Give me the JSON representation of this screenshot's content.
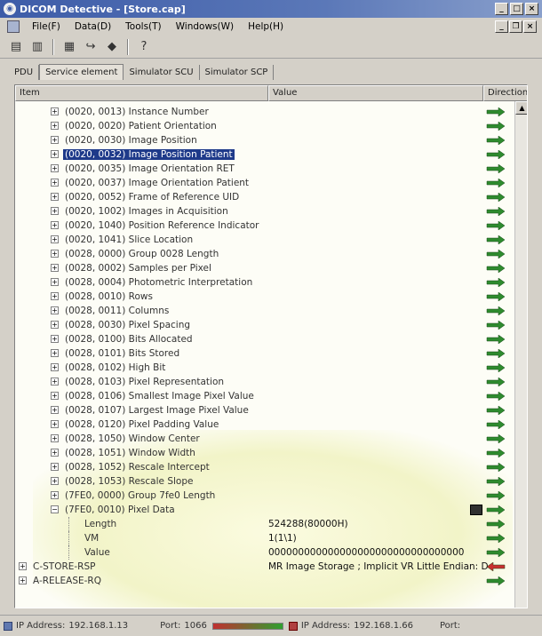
{
  "window": {
    "title": "DICOM Detective - [Store.cap]"
  },
  "menu": [
    "File(F)",
    "Data(D)",
    "Tools(T)",
    "Windows(W)",
    "Help(H)"
  ],
  "tabs": [
    "PDU",
    "Service element",
    "Simulator SCU",
    "Simulator SCP"
  ],
  "active_tab": 1,
  "columns": {
    "item": "Item",
    "value": "Value",
    "direction": "Direction"
  },
  "rows": [
    {
      "label": "(0020, 0013) Instance Number",
      "value": "",
      "dir": "out"
    },
    {
      "label": "(0020, 0020) Patient Orientation",
      "value": "",
      "dir": "out"
    },
    {
      "label": "(0020, 0030) Image Position",
      "value": "",
      "dir": "out"
    },
    {
      "label": "(0020, 0032) Image Position Patient",
      "value": "",
      "dir": "out",
      "selected": true
    },
    {
      "label": "(0020, 0035) Image Orientation RET",
      "value": "",
      "dir": "out"
    },
    {
      "label": "(0020, 0037) Image Orientation Patient",
      "value": "",
      "dir": "out"
    },
    {
      "label": "(0020, 0052) Frame of Reference UID",
      "value": "",
      "dir": "out"
    },
    {
      "label": "(0020, 1002) Images in Acquisition",
      "value": "",
      "dir": "out"
    },
    {
      "label": "(0020, 1040) Position Reference Indicator",
      "value": "",
      "dir": "out"
    },
    {
      "label": "(0020, 1041) Slice Location",
      "value": "",
      "dir": "out"
    },
    {
      "label": "(0028, 0000) Group 0028 Length",
      "value": "",
      "dir": "out"
    },
    {
      "label": "(0028, 0002) Samples per Pixel",
      "value": "",
      "dir": "out"
    },
    {
      "label": "(0028, 0004) Photometric Interpretation",
      "value": "",
      "dir": "out"
    },
    {
      "label": "(0028, 0010) Rows",
      "value": "",
      "dir": "out"
    },
    {
      "label": "(0028, 0011) Columns",
      "value": "",
      "dir": "out"
    },
    {
      "label": "(0028, 0030) Pixel Spacing",
      "value": "",
      "dir": "out"
    },
    {
      "label": "(0028, 0100) Bits Allocated",
      "value": "",
      "dir": "out"
    },
    {
      "label": "(0028, 0101) Bits Stored",
      "value": "",
      "dir": "out"
    },
    {
      "label": "(0028, 0102) High Bit",
      "value": "",
      "dir": "out"
    },
    {
      "label": "(0028, 0103) Pixel Representation",
      "value": "",
      "dir": "out"
    },
    {
      "label": "(0028, 0106) Smallest Image Pixel Value",
      "value": "",
      "dir": "out"
    },
    {
      "label": "(0028, 0107) Largest Image Pixel Value",
      "value": "",
      "dir": "out"
    },
    {
      "label": "(0028, 0120) Pixel Padding Value",
      "value": "",
      "dir": "out"
    },
    {
      "label": "(0028, 1050) Window Center",
      "value": "",
      "dir": "out"
    },
    {
      "label": "(0028, 1051) Window Width",
      "value": "",
      "dir": "out"
    },
    {
      "label": "(0028, 1052) Rescale Intercept",
      "value": "",
      "dir": "out"
    },
    {
      "label": "(0028, 1053) Rescale Slope",
      "value": "",
      "dir": "out"
    },
    {
      "label": "(7FE0, 0000) Group 7fe0 Length",
      "value": "",
      "dir": "out"
    },
    {
      "label": "(7FE0, 0010) Pixel Data",
      "value": "",
      "dir": "out",
      "expanded": true
    },
    {
      "label": "Length",
      "value": "524288(80000H)",
      "dir": "out",
      "child": true
    },
    {
      "label": "VM",
      "value": "1(1\\1)",
      "dir": "out",
      "child": true
    },
    {
      "label": "Value",
      "value": "000000000000000000000000000000000",
      "dir": "out",
      "child": true
    },
    {
      "label": "C-STORE-RSP",
      "value": "MR Image Storage ; Implicit VR Little Endian: D",
      "dir": "in",
      "top": true
    },
    {
      "label": "A-RELEASE-RQ",
      "value": "",
      "dir": "out",
      "top": true
    }
  ],
  "status": {
    "ip_label_1": "IP Address:",
    "ip_1": "192.168.1.13",
    "port_label_1": "Port:",
    "port_1": "1066",
    "ip_label_2": "IP Address:",
    "ip_2": "192.168.1.66",
    "port_label_2": "Port:"
  },
  "colors": {
    "out_arrow": "#2e8b2e",
    "in_arrow": "#c83030",
    "selection": "#1e3a8a"
  }
}
